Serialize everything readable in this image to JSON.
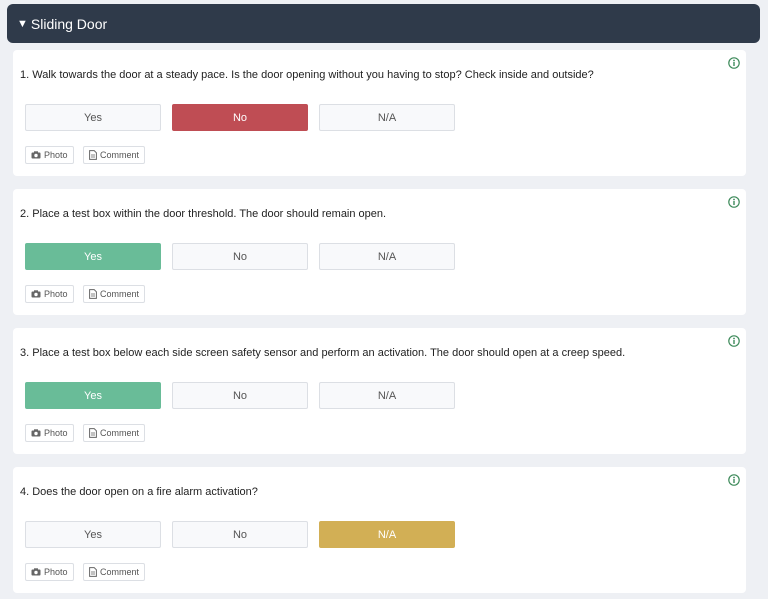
{
  "section": {
    "caret": "▼",
    "title": "Sliding Door"
  },
  "actions": {
    "photo_label": "Photo",
    "comment_label": "Comment"
  },
  "options": [
    "Yes",
    "No",
    "N/A"
  ],
  "colors": {
    "no": "#bf4d54",
    "yes": "#69bc98",
    "na": "#d2af55",
    "info": "#3d8a5a",
    "header": "#2f3a4a"
  },
  "questions": [
    {
      "text": "1. Walk towards the door at a steady pace. Is the door opening without you having to stop? Check inside and outside?",
      "selected": "No"
    },
    {
      "text": "2. Place a test box within the door threshold. The door should remain open.",
      "selected": "Yes"
    },
    {
      "text": "3. Place a test box below each side screen safety sensor and perform an activation. The door should open at a creep speed.",
      "selected": "Yes"
    },
    {
      "text": "4. Does the door open on a fire alarm activation?",
      "selected": "N/A"
    }
  ]
}
